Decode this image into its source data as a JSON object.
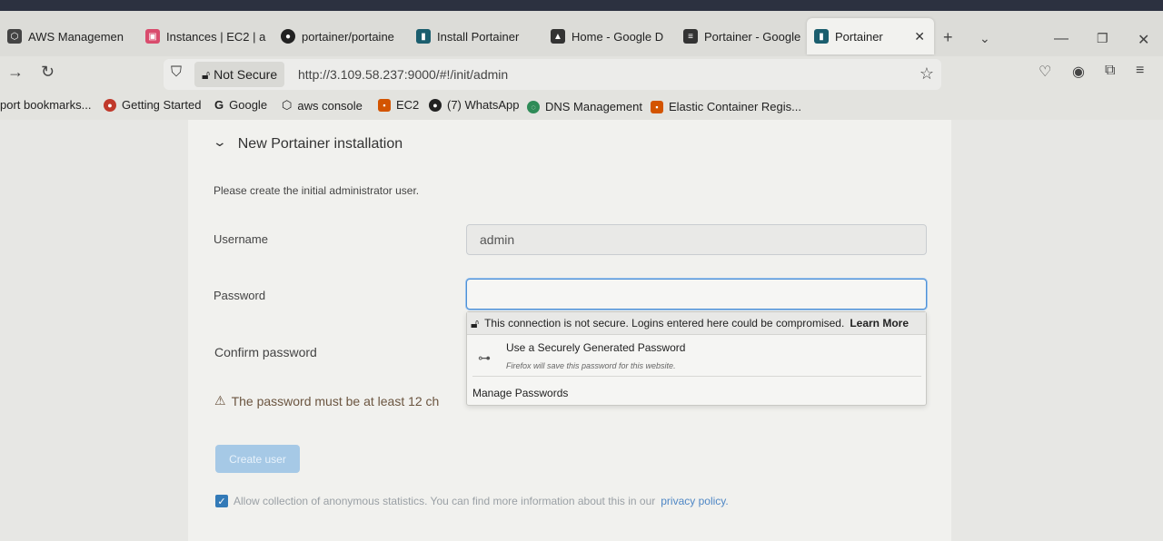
{
  "tabs": [
    {
      "label": "AWS Managemen",
      "icon": "aws-icon"
    },
    {
      "label": "Instances | EC2 | a",
      "icon": "ec2-icon"
    },
    {
      "label": "portainer/portaine",
      "icon": "github-icon"
    },
    {
      "label": "Install Portainer",
      "icon": "portainer-icon"
    },
    {
      "label": "Home - Google D",
      "icon": "google-drive-icon"
    },
    {
      "label": "Portainer - Google",
      "icon": "google-docs-icon"
    },
    {
      "label": "Portainer",
      "icon": "portainer-icon",
      "active": true
    }
  ],
  "address": {
    "security_label": "Not Secure",
    "url": "http://3.109.58.237:9000/#!/init/admin"
  },
  "bookmarks": [
    {
      "label": "port bookmarks..."
    },
    {
      "label": "Getting Started"
    },
    {
      "label": "Google"
    },
    {
      "label": "aws console"
    },
    {
      "label": "EC2"
    },
    {
      "label": "(7) WhatsApp"
    },
    {
      "label": "DNS Management"
    },
    {
      "label": "Elastic Container Regis..."
    }
  ],
  "form": {
    "section_title": "New Portainer installation",
    "intro": "Please create the initial administrator user.",
    "username_label": "Username",
    "username_value": "admin",
    "password_label": "Password",
    "confirm_label": "Confirm password",
    "warning": "The password must be at least 12 ch",
    "create_button": "Create user",
    "stats_text": "Allow collection of anonymous statistics. You can find more information about this in our",
    "stats_link": "privacy policy.",
    "stats_checked": true
  },
  "popup": {
    "insecure_text": "This connection is not secure. Logins entered here could be compromised.",
    "learn_more": "Learn More",
    "generate_title": "Use a Securely Generated Password",
    "generate_sub": "Firefox will save this password for this website.",
    "manage": "Manage Passwords"
  },
  "colors": {
    "accent": "#337ab7",
    "button_disabled": "#a6c9e6",
    "focus_border": "#4d90d6"
  }
}
